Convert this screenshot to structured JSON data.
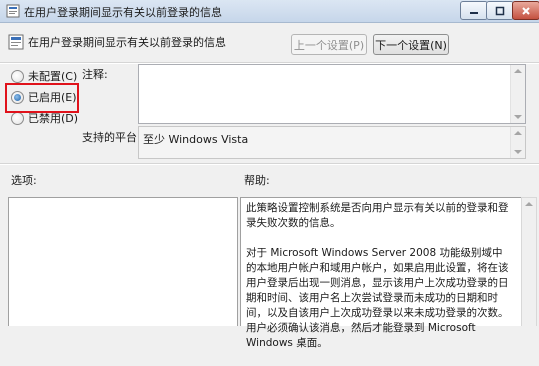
{
  "window": {
    "title": "在用户登录期间显示有关以前登录的信息",
    "controls": {
      "minimize": "—",
      "maximize": "□",
      "close": "✕"
    }
  },
  "header": {
    "policy_title": "在用户登录期间显示有关以前登录的信息",
    "prev_button": "上一个设置(P)",
    "next_button": "下一个设置(N)"
  },
  "state_options": [
    {
      "label": "未配置(C)",
      "checked": false
    },
    {
      "label": "已启用(E)",
      "checked": true
    },
    {
      "label": "已禁用(D)",
      "checked": false
    }
  ],
  "comment": {
    "label": "注释:",
    "value": ""
  },
  "platform": {
    "label": "支持的平台:",
    "value": "至少 Windows Vista"
  },
  "options": {
    "label": "选项:"
  },
  "help": {
    "label": "帮助:",
    "paragraphs": [
      "此策略设置控制系统是否向用户显示有关以前的登录和登录失败次数的信息。",
      "对于 Microsoft Windows Server 2008 功能级别域中的本地用户帐户和域用户帐户，如果启用此设置，将在该用户登录后出现一则消息，显示该用户上次成功登录的日期和时间、该用户名上次尝试登录而未成功的日期和时间，以及自该用户上次成功登录以来未成功登录的次数。用户必须确认该消息，然后才能登录到 Microsoft Windows 桌面。"
    ]
  },
  "colors": {
    "highlight_box": "#e0121b",
    "title_bar": "#c6d6ea"
  }
}
